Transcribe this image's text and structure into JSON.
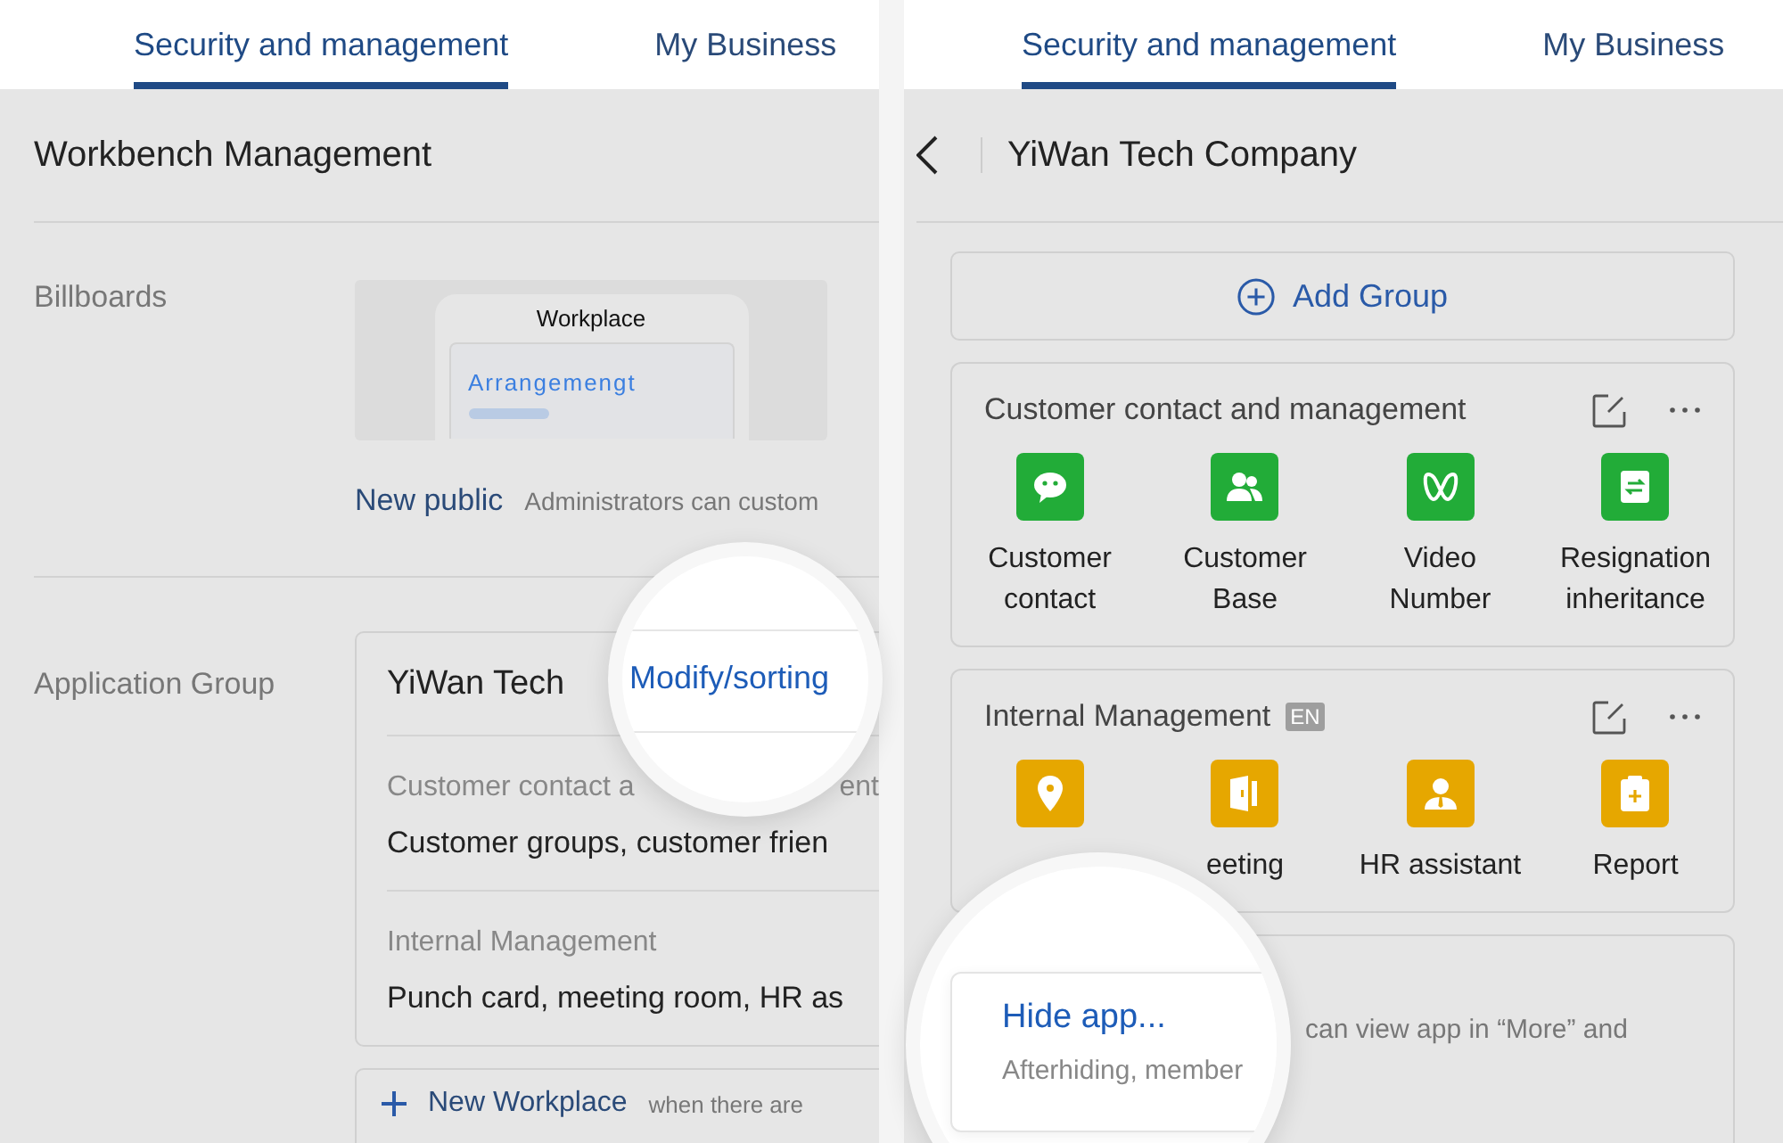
{
  "left_panel": {
    "tabs": [
      {
        "label": "Security and management",
        "selected": true
      },
      {
        "label": "My Business",
        "selected": false
      }
    ],
    "title": "Workbench Management",
    "billboards": {
      "label": "Billboards",
      "preview": {
        "title": "Workplace",
        "card_text": "Arrangemengt"
      },
      "link": "New public",
      "hint": "Administrators can custom"
    },
    "application_group": {
      "label": "Application Group",
      "card": {
        "name": "YiWan Tech",
        "rows": [
          {
            "label": [
              "Customer contact a",
              "ent"
            ],
            "apps": "Customer groups, customer frien"
          },
          {
            "label": [
              "Internal Management"
            ],
            "apps": "Punch card, meeting room, HR as"
          }
        ]
      },
      "new_workplace": {
        "link": "New Workplace",
        "hint": "when there are"
      }
    },
    "magnifier": {
      "text": "Modify/sorting"
    }
  },
  "right_panel": {
    "tabs": [
      {
        "label": "Security and management",
        "selected": true
      },
      {
        "label": "My Business",
        "selected": false
      }
    ],
    "title": "YiWan Tech Company",
    "add_group": "Add Group",
    "groups": [
      {
        "title": "Customer contact and management",
        "color": "#22ac38",
        "apps": [
          {
            "kind": "chat",
            "label": "Customer contact"
          },
          {
            "kind": "people",
            "label": "Customer Base"
          },
          {
            "kind": "video",
            "label": "Video Number"
          },
          {
            "kind": "swap",
            "label": "Resignation inheritance"
          }
        ]
      },
      {
        "title": "Internal Management",
        "badge": "EN",
        "color": "#e6a700",
        "apps": [
          {
            "kind": "pin"
          },
          {
            "kind": "door",
            "label": "eeting"
          },
          {
            "kind": "person",
            "label": "HR assistant"
          },
          {
            "kind": "report",
            "label": "Report"
          }
        ]
      }
    ],
    "partial_card": {
      "text": "can view app in “More” and"
    },
    "magnifier": {
      "title": "Hide app...",
      "text": "Afterhiding, member"
    }
  }
}
